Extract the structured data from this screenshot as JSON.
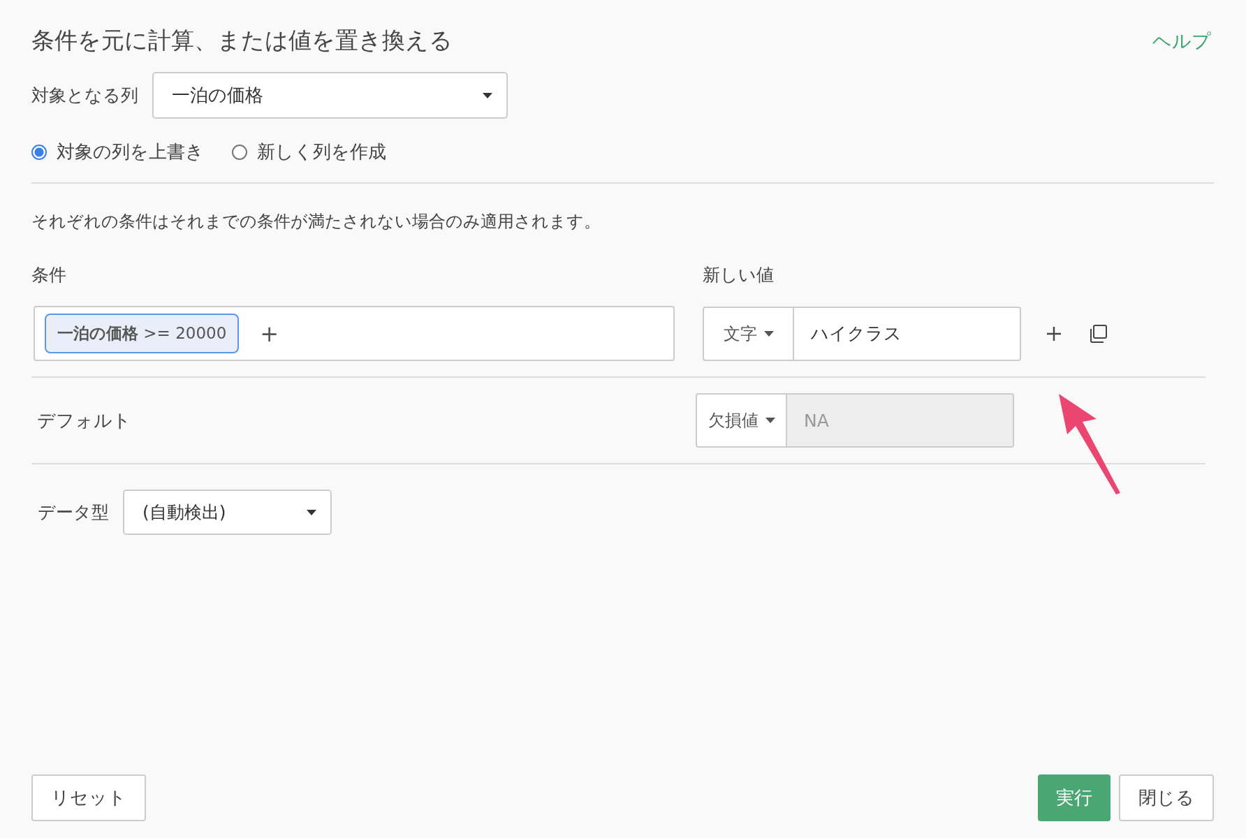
{
  "title": "条件を元に計算、または値を置き換える",
  "help_link": "ヘルプ",
  "target_column": {
    "label": "対象となる列",
    "value": "一泊の価格"
  },
  "output_options": [
    {
      "label": "対象の列を上書き",
      "selected": true
    },
    {
      "label": "新しく列を作成",
      "selected": false
    }
  ],
  "note": "それぞれの条件はそれまでの条件が満たされない場合のみ適用されます。",
  "condition_header": "条件",
  "new_value_header": "新しい値",
  "conditions": [
    {
      "chips": [
        "**一泊の価格** >= 20000"
      ],
      "add_symbol": "+",
      "value_type": "文字",
      "value": "ハイクラス",
      "disabled": false
    }
  ],
  "default": {
    "label": "デフォルト",
    "value_type": "欠損値",
    "value": "NA",
    "disabled": true
  },
  "data_type": {
    "label": "データ型",
    "value": "(自動検出)"
  },
  "buttons": {
    "reset": "リセット",
    "run": "実行",
    "close": "閉じる"
  }
}
